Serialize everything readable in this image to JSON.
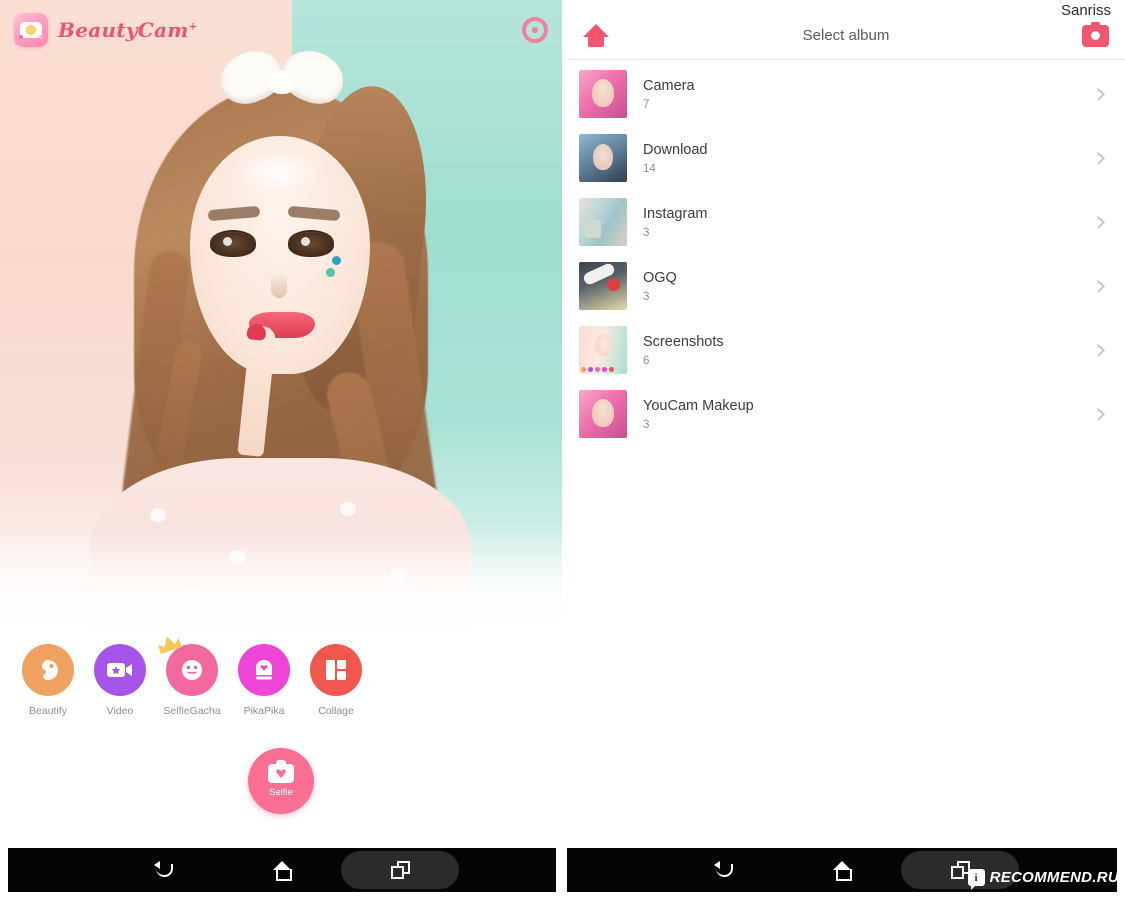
{
  "left_app": {
    "brand": "BeautyCam",
    "brand_mark": "+",
    "logo_icon": "beautycam-app-logo",
    "settings_icon": "settings-gear-icon",
    "features": [
      {
        "label": "Beautify",
        "color": "#f0a05f",
        "icon": "beautify-face-icon"
      },
      {
        "label": "Video",
        "color": "#a755e8",
        "icon": "video-camera-icon"
      },
      {
        "label": "SelfieGacha",
        "color": "#f3689f",
        "icon": "smiley-crown-icon"
      },
      {
        "label": "PikaPika",
        "color": "#ef45d6",
        "icon": "sticker-heart-icon"
      },
      {
        "label": "Collage",
        "color": "#f0584d",
        "icon": "collage-grid-icon"
      }
    ],
    "selfie_button": {
      "label": "Selfie",
      "color": "#fa6f92",
      "icon": "camera-heart-icon"
    }
  },
  "right_app": {
    "account_name": "Sanriss",
    "home_icon": "home-icon",
    "title": "Select album",
    "camera_icon": "camera-icon",
    "chevron_icon": "chevron-right-icon",
    "albums": [
      {
        "name": "Camera",
        "count": "7",
        "thumb": "pink-haired-girl-photo"
      },
      {
        "name": "Download",
        "count": "14",
        "thumb": "blue-haired-girl-photo"
      },
      {
        "name": "Instagram",
        "count": "3",
        "thumb": "flatlay-objects-photo"
      },
      {
        "name": "OGQ",
        "count": "3",
        "thumb": "dark-object-photo"
      },
      {
        "name": "Screenshots",
        "count": "6",
        "thumb": "beautycam-screenshot"
      },
      {
        "name": "YouCam Makeup",
        "count": "3",
        "thumb": "pink-haired-girl-photo"
      }
    ]
  },
  "navbar": {
    "back_icon": "back-arrow-icon",
    "home_icon": "home-outline-icon",
    "recents_icon": "recent-apps-icon"
  },
  "watermark": {
    "badge": "i",
    "text": "RECOMMEND.RU"
  },
  "colors": {
    "brand_pink": "#f0526f",
    "accent_pink": "#f4556e",
    "photo_bg_left": "#fad9cd",
    "photo_bg_right": "#9fdfd0"
  }
}
